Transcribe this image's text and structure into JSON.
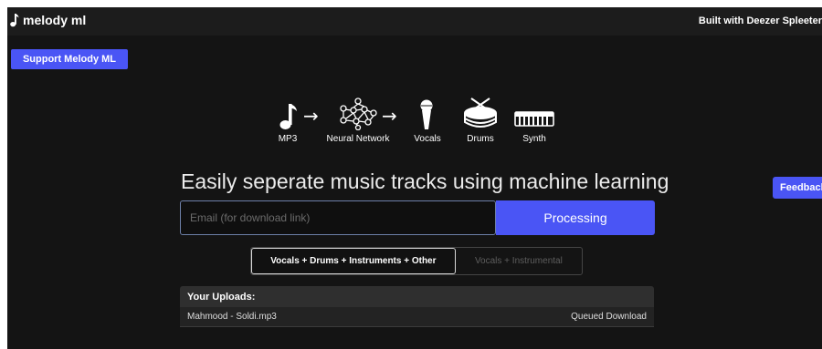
{
  "header": {
    "brand_name": "melody ml",
    "built_with": "Built with Deezer Spleeter"
  },
  "support_button": "Support Melody ML",
  "feedback_button": "Feedback",
  "pipeline": {
    "items": [
      {
        "label": "MP3",
        "icon": "music-note-icon"
      },
      {
        "label": "Neural Network",
        "icon": "neural-network-icon"
      },
      {
        "label": "Vocals",
        "icon": "microphone-icon"
      },
      {
        "label": "Drums",
        "icon": "drum-icon"
      },
      {
        "label": "Synth",
        "icon": "keyboard-icon"
      }
    ],
    "arrow": "→"
  },
  "headline": "Easily seperate music tracks using machine learning",
  "form": {
    "email_placeholder": "Email (for download link)",
    "email_value": "",
    "submit_label": "Processing"
  },
  "modes": {
    "options": [
      "Vocals + Drums + Instruments + Other",
      "Vocals + Instrumental"
    ],
    "selected": "Vocals + Drums + Instruments + Other"
  },
  "uploads": {
    "title": "Your Uploads:",
    "rows": [
      {
        "filename": "Mahmood - Soldi.mp3",
        "status": "Queued Download"
      }
    ]
  },
  "colors": {
    "accent": "#4a55f5",
    "background": "#141414",
    "topbar": "#1c1c1c"
  }
}
